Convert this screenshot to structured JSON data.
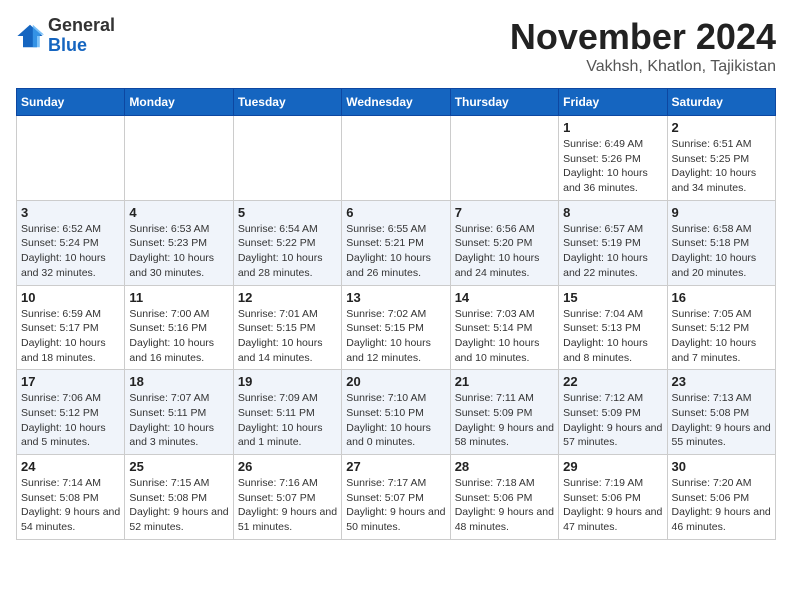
{
  "logo": {
    "general": "General",
    "blue": "Blue"
  },
  "title": "November 2024",
  "location": "Vakhsh, Khatlon, Tajikistan",
  "days_of_week": [
    "Sunday",
    "Monday",
    "Tuesday",
    "Wednesday",
    "Thursday",
    "Friday",
    "Saturday"
  ],
  "weeks": [
    [
      {
        "day": "",
        "info": ""
      },
      {
        "day": "",
        "info": ""
      },
      {
        "day": "",
        "info": ""
      },
      {
        "day": "",
        "info": ""
      },
      {
        "day": "",
        "info": ""
      },
      {
        "day": "1",
        "info": "Sunrise: 6:49 AM\nSunset: 5:26 PM\nDaylight: 10 hours and 36 minutes."
      },
      {
        "day": "2",
        "info": "Sunrise: 6:51 AM\nSunset: 5:25 PM\nDaylight: 10 hours and 34 minutes."
      }
    ],
    [
      {
        "day": "3",
        "info": "Sunrise: 6:52 AM\nSunset: 5:24 PM\nDaylight: 10 hours and 32 minutes."
      },
      {
        "day": "4",
        "info": "Sunrise: 6:53 AM\nSunset: 5:23 PM\nDaylight: 10 hours and 30 minutes."
      },
      {
        "day": "5",
        "info": "Sunrise: 6:54 AM\nSunset: 5:22 PM\nDaylight: 10 hours and 28 minutes."
      },
      {
        "day": "6",
        "info": "Sunrise: 6:55 AM\nSunset: 5:21 PM\nDaylight: 10 hours and 26 minutes."
      },
      {
        "day": "7",
        "info": "Sunrise: 6:56 AM\nSunset: 5:20 PM\nDaylight: 10 hours and 24 minutes."
      },
      {
        "day": "8",
        "info": "Sunrise: 6:57 AM\nSunset: 5:19 PM\nDaylight: 10 hours and 22 minutes."
      },
      {
        "day": "9",
        "info": "Sunrise: 6:58 AM\nSunset: 5:18 PM\nDaylight: 10 hours and 20 minutes."
      }
    ],
    [
      {
        "day": "10",
        "info": "Sunrise: 6:59 AM\nSunset: 5:17 PM\nDaylight: 10 hours and 18 minutes."
      },
      {
        "day": "11",
        "info": "Sunrise: 7:00 AM\nSunset: 5:16 PM\nDaylight: 10 hours and 16 minutes."
      },
      {
        "day": "12",
        "info": "Sunrise: 7:01 AM\nSunset: 5:15 PM\nDaylight: 10 hours and 14 minutes."
      },
      {
        "day": "13",
        "info": "Sunrise: 7:02 AM\nSunset: 5:15 PM\nDaylight: 10 hours and 12 minutes."
      },
      {
        "day": "14",
        "info": "Sunrise: 7:03 AM\nSunset: 5:14 PM\nDaylight: 10 hours and 10 minutes."
      },
      {
        "day": "15",
        "info": "Sunrise: 7:04 AM\nSunset: 5:13 PM\nDaylight: 10 hours and 8 minutes."
      },
      {
        "day": "16",
        "info": "Sunrise: 7:05 AM\nSunset: 5:12 PM\nDaylight: 10 hours and 7 minutes."
      }
    ],
    [
      {
        "day": "17",
        "info": "Sunrise: 7:06 AM\nSunset: 5:12 PM\nDaylight: 10 hours and 5 minutes."
      },
      {
        "day": "18",
        "info": "Sunrise: 7:07 AM\nSunset: 5:11 PM\nDaylight: 10 hours and 3 minutes."
      },
      {
        "day": "19",
        "info": "Sunrise: 7:09 AM\nSunset: 5:11 PM\nDaylight: 10 hours and 1 minute."
      },
      {
        "day": "20",
        "info": "Sunrise: 7:10 AM\nSunset: 5:10 PM\nDaylight: 10 hours and 0 minutes."
      },
      {
        "day": "21",
        "info": "Sunrise: 7:11 AM\nSunset: 5:09 PM\nDaylight: 9 hours and 58 minutes."
      },
      {
        "day": "22",
        "info": "Sunrise: 7:12 AM\nSunset: 5:09 PM\nDaylight: 9 hours and 57 minutes."
      },
      {
        "day": "23",
        "info": "Sunrise: 7:13 AM\nSunset: 5:08 PM\nDaylight: 9 hours and 55 minutes."
      }
    ],
    [
      {
        "day": "24",
        "info": "Sunrise: 7:14 AM\nSunset: 5:08 PM\nDaylight: 9 hours and 54 minutes."
      },
      {
        "day": "25",
        "info": "Sunrise: 7:15 AM\nSunset: 5:08 PM\nDaylight: 9 hours and 52 minutes."
      },
      {
        "day": "26",
        "info": "Sunrise: 7:16 AM\nSunset: 5:07 PM\nDaylight: 9 hours and 51 minutes."
      },
      {
        "day": "27",
        "info": "Sunrise: 7:17 AM\nSunset: 5:07 PM\nDaylight: 9 hours and 50 minutes."
      },
      {
        "day": "28",
        "info": "Sunrise: 7:18 AM\nSunset: 5:06 PM\nDaylight: 9 hours and 48 minutes."
      },
      {
        "day": "29",
        "info": "Sunrise: 7:19 AM\nSunset: 5:06 PM\nDaylight: 9 hours and 47 minutes."
      },
      {
        "day": "30",
        "info": "Sunrise: 7:20 AM\nSunset: 5:06 PM\nDaylight: 9 hours and 46 minutes."
      }
    ]
  ]
}
